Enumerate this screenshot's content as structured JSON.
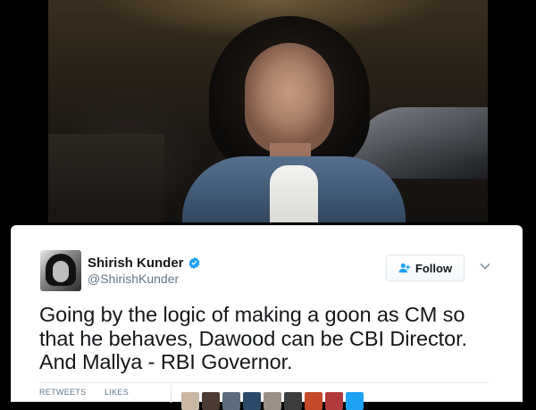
{
  "tweet": {
    "display_name": "Shirish Kunder",
    "handle": "@ShirishKunder",
    "verified": true,
    "follow_label": "Follow",
    "text_lines": [
      "Going by the logic of making a goon as CM so",
      "that he behaves, Dawood can be CBI Director.",
      "And Mallya - RBI Governor."
    ],
    "stats": {
      "retweets_label": "RETWEETS",
      "likes_label": "LIKES"
    },
    "likers": [
      {
        "color": "#c9b8a4"
      },
      {
        "color": "#4a3b33"
      },
      {
        "color": "#5c6c7a"
      },
      {
        "color": "#2b4a6a"
      },
      {
        "color": "#9a8f86"
      },
      {
        "color": "#3d3d3d"
      },
      {
        "color": "#c44a2a"
      },
      {
        "color": "#b23a3a"
      },
      {
        "color": "#1da1f2"
      }
    ]
  },
  "colors": {
    "verified_blue": "#1da1f2",
    "text_primary": "#14171a",
    "text_secondary": "#657786",
    "border": "#e1e8ed"
  }
}
